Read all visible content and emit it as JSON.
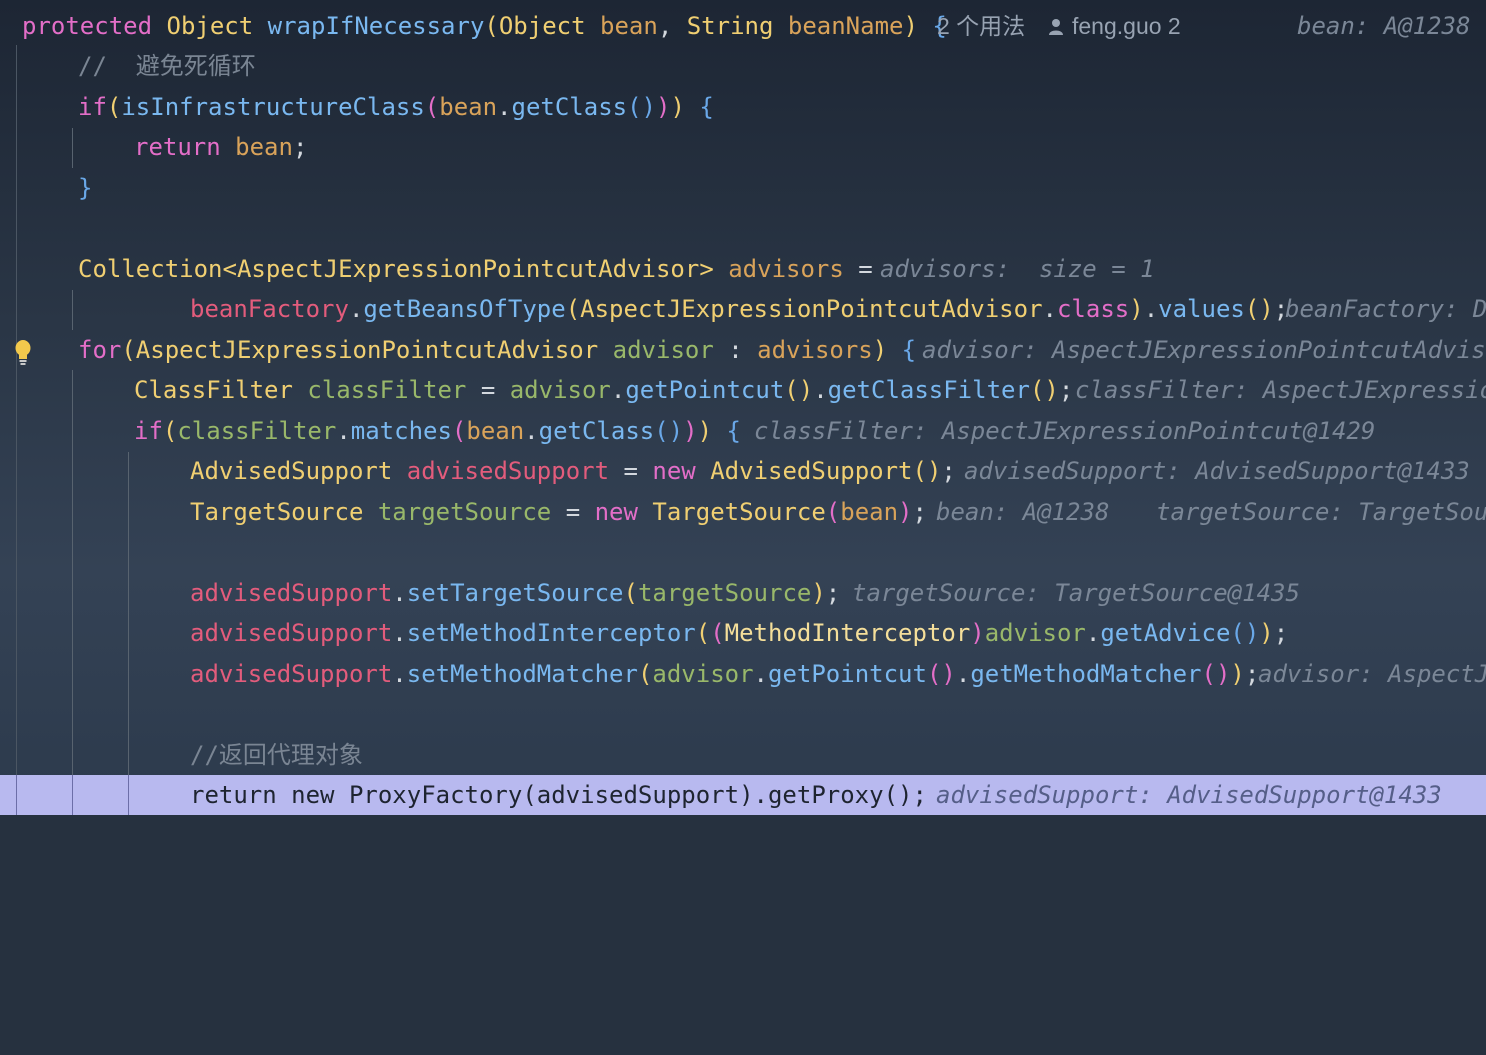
{
  "editor": {
    "usages": "2 个用法",
    "author": "feng.guo 2",
    "lines": {
      "l1_hint": "bean: A@1238",
      "l2_comment": "//  避免死循环",
      "l7_hint": "advisors:  size = 1",
      "l8_hint": "beanFactory: De",
      "l9_hint": "advisor: AspectJExpressionPointcutAdvisor",
      "l10_hint": "classFilter: AspectJExpression",
      "l11_hint": "classFilter: AspectJExpressionPointcut@1429",
      "l12_hint": "advisedSupport: AdvisedSupport@1433",
      "l13_hint_a": "bean: A@1238",
      "l13_hint_b": "targetSource: TargetSour",
      "l15_hint": "targetSource: TargetSource@1435",
      "l17_hint": "advisor: AspectJ",
      "l19_comment": "//返回代理对象",
      "l20_hint": "advisedSupport: AdvisedSupport@1433"
    }
  },
  "icons": {
    "author": "person-icon",
    "intention": "lightbulb-icon"
  }
}
